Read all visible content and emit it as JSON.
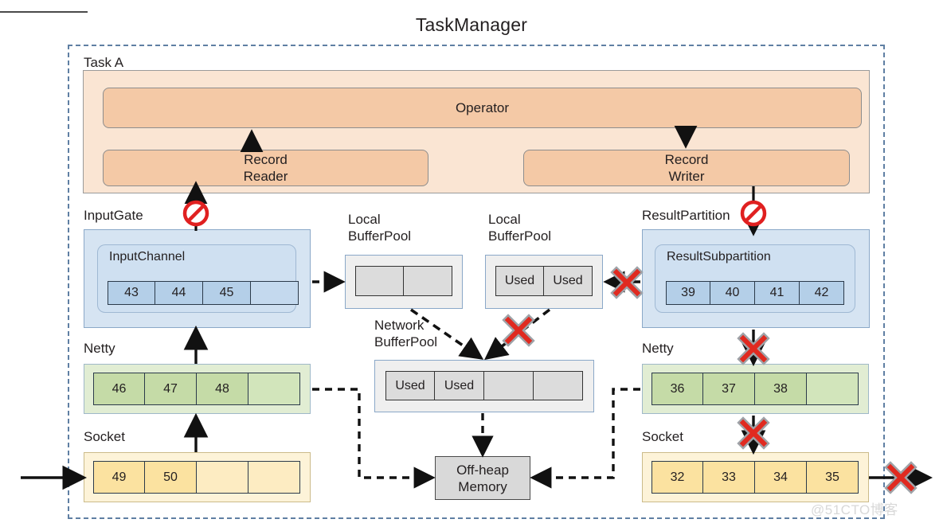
{
  "title": "TaskManager",
  "task": {
    "label": "Task A"
  },
  "operator": {
    "label": "Operator"
  },
  "record_reader": {
    "label": "Record\nReader"
  },
  "record_writer": {
    "label": "Record\nWriter"
  },
  "input_gate": {
    "label": "InputGate",
    "channel_label": "InputChannel",
    "cells": [
      "43",
      "44",
      "45",
      ""
    ]
  },
  "result_partition": {
    "label": "ResultPartition",
    "subpartition_label": "ResultSubpartition",
    "cells": [
      "39",
      "40",
      "41",
      "42"
    ]
  },
  "local_buffer_pool_left": {
    "label": "Local\nBufferPool",
    "cells": [
      "",
      ""
    ]
  },
  "local_buffer_pool_right": {
    "label": "Local\nBufferPool",
    "cells": [
      "Used",
      "Used"
    ]
  },
  "network_buffer_pool": {
    "label": "Network\nBufferPool",
    "cells": [
      "Used",
      "Used",
      "",
      ""
    ]
  },
  "netty_left": {
    "label": "Netty",
    "cells": [
      "46",
      "47",
      "48",
      ""
    ]
  },
  "socket_left": {
    "label": "Socket",
    "cells": [
      "49",
      "50",
      "",
      ""
    ]
  },
  "netty_right": {
    "label": "Netty",
    "cells": [
      "36",
      "37",
      "38",
      ""
    ]
  },
  "socket_right": {
    "label": "Socket",
    "cells": [
      "32",
      "33",
      "34",
      "35"
    ]
  },
  "off_heap": {
    "label": "Off-heap\nMemory"
  },
  "watermark": {
    "text": "@51CTO博客"
  },
  "markers": {
    "blocked_icon": "no-entry-icon",
    "cross_icon": "red-x-icon"
  },
  "colors": {
    "task_panel": "#fae5d3",
    "operator": "#f4c9a6",
    "gate": "#d6e4f2",
    "cell_blue": "#b4cfe8",
    "cell_green": "#c5dba7",
    "cell_yellow": "#fbe2a0",
    "cell_gray": "#dcdcdc",
    "dashed_border": "#5f7fa3",
    "marker_red": "#e02020"
  }
}
